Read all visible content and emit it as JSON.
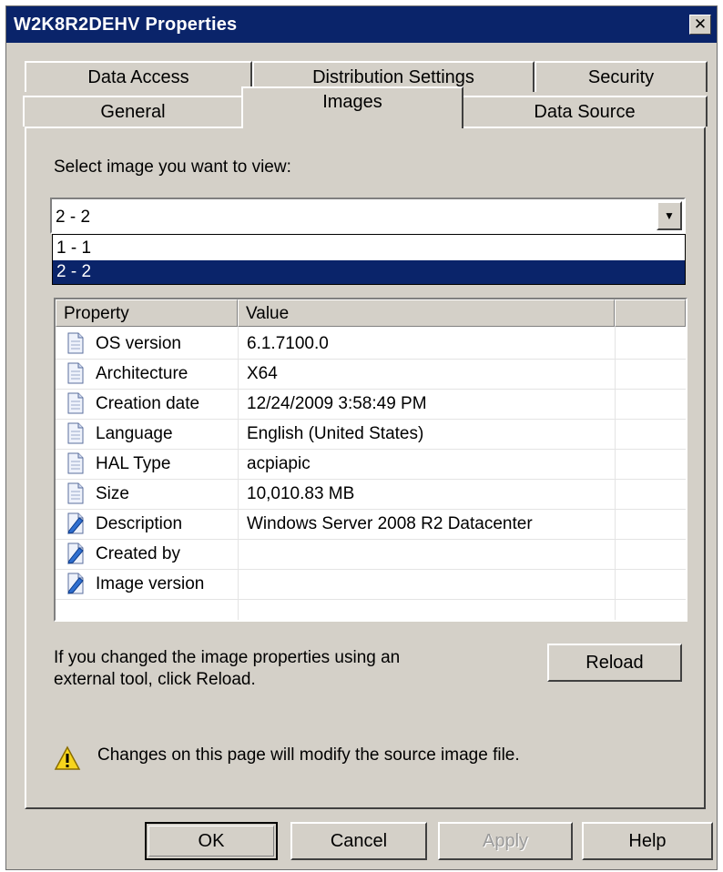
{
  "window": {
    "title": "W2K8R2DEHV Properties",
    "close_glyph": "✕"
  },
  "tabs": {
    "row_back": [
      {
        "label": "Data Access"
      },
      {
        "label": "Distribution Settings"
      },
      {
        "label": "Security"
      }
    ],
    "row_front": [
      {
        "label": "General"
      },
      {
        "label": "Images",
        "active": true
      },
      {
        "label": "Data Source"
      }
    ]
  },
  "images_tab": {
    "select_label": "Select image you want to view:",
    "image_select": {
      "value": "2 - 2",
      "options": [
        "1 - 1",
        "2 - 2"
      ],
      "selected_index": 1
    },
    "properties": {
      "columns": [
        "Property",
        "Value"
      ],
      "rows": [
        {
          "icon": "document-icon",
          "property": "OS version",
          "value": "6.1.7100.0"
        },
        {
          "icon": "document-icon",
          "property": "Architecture",
          "value": "X64"
        },
        {
          "icon": "document-icon",
          "property": "Creation date",
          "value": "12/24/2009 3:58:49 PM"
        },
        {
          "icon": "document-icon",
          "property": "Language",
          "value": "English (United States)"
        },
        {
          "icon": "document-icon",
          "property": "HAL Type",
          "value": "acpiapic"
        },
        {
          "icon": "document-icon",
          "property": "Size",
          "value": "10,010.83 MB"
        },
        {
          "icon": "editable-icon",
          "property": "Description",
          "value": "Windows Server 2008 R2 Datacenter"
        },
        {
          "icon": "editable-icon",
          "property": "Created by",
          "value": ""
        },
        {
          "icon": "editable-icon",
          "property": "Image version",
          "value": ""
        }
      ]
    },
    "reload_note_line1": "If you changed the image properties using an",
    "reload_note_line2": "external tool, click Reload.",
    "reload_label": "Reload",
    "warning_text": "Changes on this page will modify the source image file."
  },
  "buttons": {
    "ok": "OK",
    "cancel": "Cancel",
    "apply": "Apply",
    "help": "Help"
  },
  "colors": {
    "dialog_face": "#d4d0c8",
    "title_bar": "#0a246a",
    "selection": "#0a246a"
  }
}
